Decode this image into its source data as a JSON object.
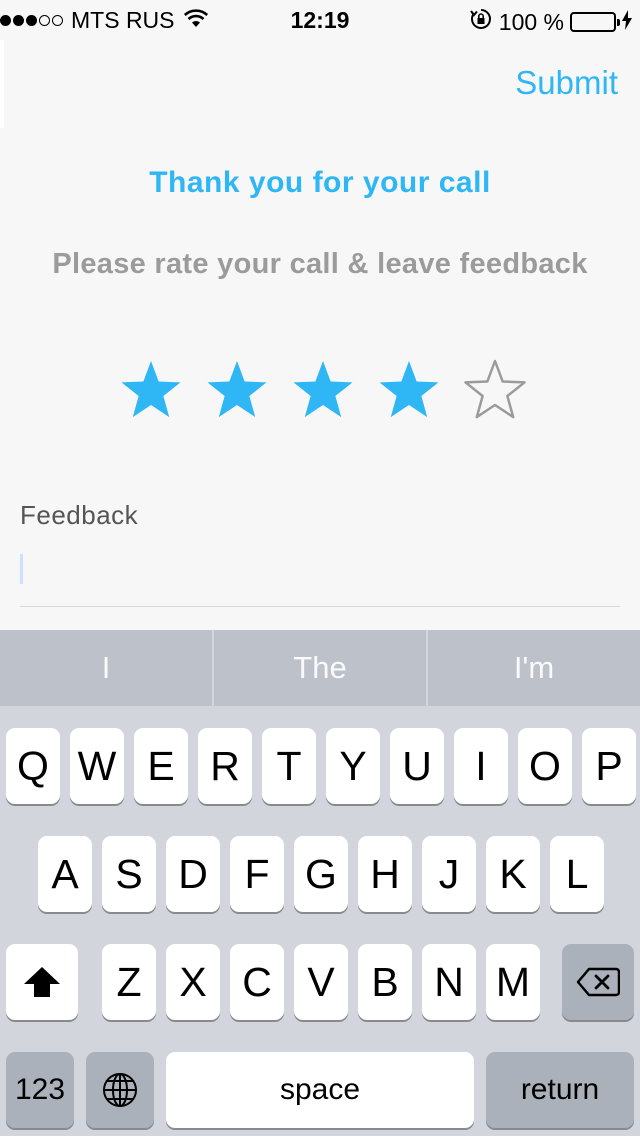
{
  "status_bar": {
    "carrier": "MTS RUS",
    "time": "12:19",
    "battery": "100 %",
    "signal_filled": 3,
    "signal_total": 5,
    "icons": [
      "wifi-icon",
      "rotation-lock-icon",
      "battery-icon",
      "charging-icon"
    ],
    "battery_color": "#4cd964"
  },
  "header": {
    "submit_label": "Submit"
  },
  "main": {
    "title": "Thank you for your call",
    "subtitle": "Please rate your call & leave feedback",
    "rating": {
      "value": 4,
      "max": 5
    },
    "feedback_label": "Feedback",
    "feedback_value": ""
  },
  "keyboard": {
    "suggestions": [
      "I",
      "The",
      "I'm"
    ],
    "row1": [
      "Q",
      "W",
      "E",
      "R",
      "T",
      "Y",
      "U",
      "I",
      "O",
      "P"
    ],
    "row2": [
      "A",
      "S",
      "D",
      "F",
      "G",
      "H",
      "J",
      "K",
      "L"
    ],
    "row3": [
      "Z",
      "X",
      "C",
      "V",
      "B",
      "N",
      "M"
    ],
    "numbers_label": "123",
    "space_label": "space",
    "return_label": "return"
  },
  "colors": {
    "accent": "#2eb6f5",
    "star_empty": "#9b9b9b",
    "subtitle": "#9b9b9b"
  }
}
